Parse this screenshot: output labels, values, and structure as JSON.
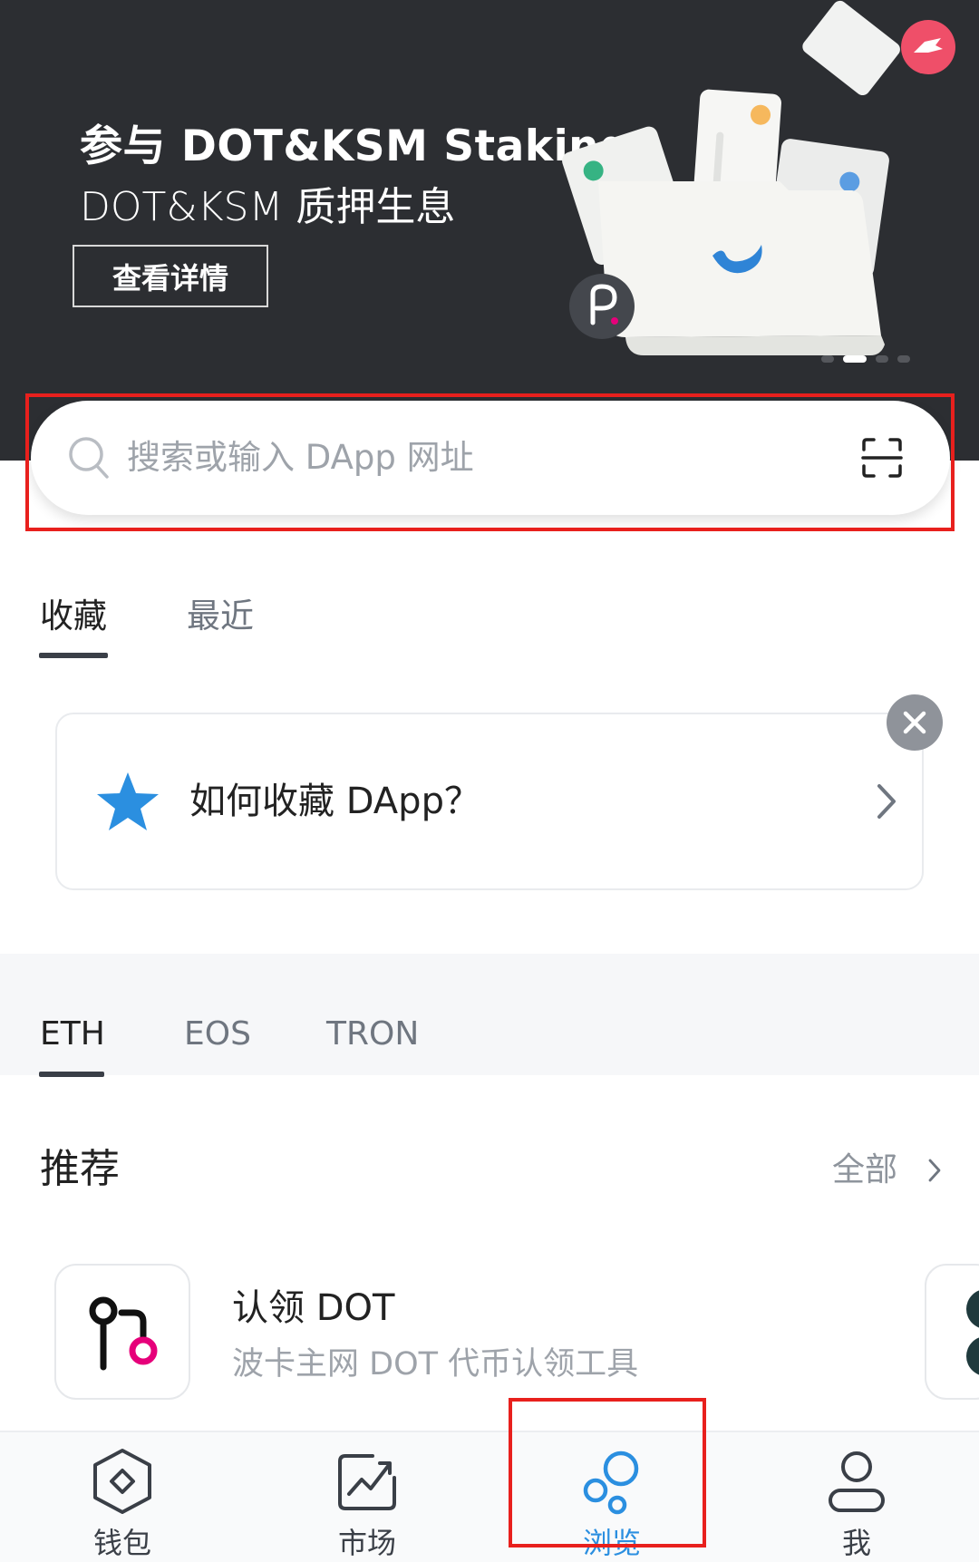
{
  "banner": {
    "title": "参与 DOT&KSM Staking",
    "subtitle": "DOT&KSM 质押生息",
    "button_label": "查看详情",
    "dots_count": 4,
    "active_dot": 2
  },
  "search": {
    "placeholder": "搜索或输入 DApp 网址"
  },
  "fav_tabs": {
    "items": [
      {
        "label": "收藏",
        "active": true
      },
      {
        "label": "最近",
        "active": false
      }
    ]
  },
  "fav_card": {
    "text": "如何收藏 DApp？"
  },
  "chain_tabs": {
    "items": [
      {
        "label": "ETH",
        "active": true
      },
      {
        "label": "EOS",
        "active": false
      },
      {
        "label": "TRON",
        "active": false
      }
    ]
  },
  "recommend": {
    "title": "推荐",
    "all_label": "全部",
    "items": [
      {
        "name": "认领 DOT",
        "desc": "波卡主网 DOT 代币认领工具"
      }
    ]
  },
  "bottom_nav": {
    "items": [
      {
        "label": "钱包",
        "icon": "wallet-icon",
        "active": false
      },
      {
        "label": "市场",
        "icon": "market-icon",
        "active": false
      },
      {
        "label": "浏览",
        "icon": "browse-icon",
        "active": true
      },
      {
        "label": "我",
        "icon": "profile-icon",
        "active": false
      }
    ]
  },
  "colors": {
    "accent": "#2b8fe0",
    "banner_bg": "#2c2e32",
    "highlight": "#e8201d",
    "star": "#2b8fe0"
  }
}
